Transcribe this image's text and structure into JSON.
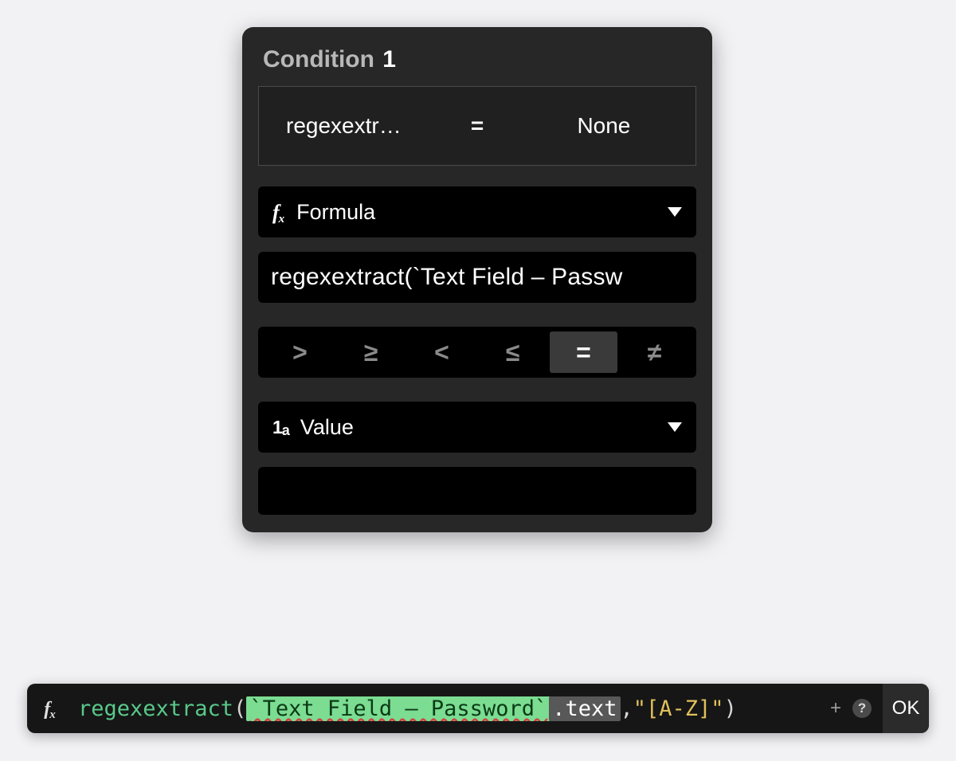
{
  "panel": {
    "title_prefix": "Condition",
    "title_number": "1",
    "preview": {
      "left": "regexextr…",
      "operator": "=",
      "right": "None"
    },
    "formula_dropdown_label": "Formula",
    "formula_text": "regexextract(`Text Field – Passw",
    "operators": [
      ">",
      "≥",
      "<",
      "≤",
      "=",
      "≠"
    ],
    "operator_selected_index": 4,
    "value_dropdown_label": "Value"
  },
  "formula_bar": {
    "func": "regexextract",
    "open_paren": "(",
    "ref": "`Text Field – Password`",
    "prop": ".text",
    "comma": ",",
    "str": "\"[A-Z]\"",
    "close_paren": ")",
    "ok_label": "OK"
  }
}
